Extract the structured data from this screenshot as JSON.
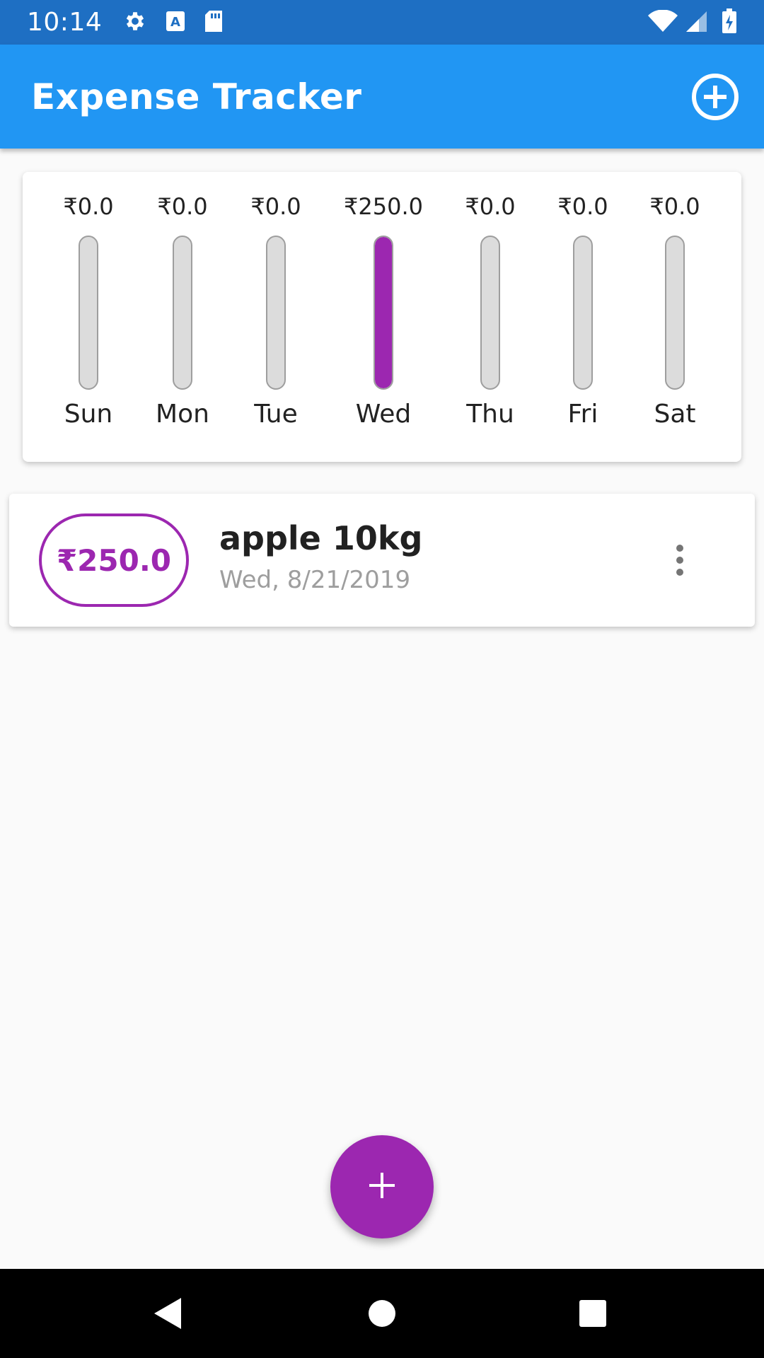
{
  "status_bar": {
    "time": "10:14",
    "left_icons": [
      "settings-icon",
      "a-notification-icon",
      "sd-card-icon"
    ],
    "right_icons": [
      "wifi-icon",
      "cell-signal-icon",
      "battery-charging-icon"
    ]
  },
  "app_bar": {
    "title": "Expense Tracker",
    "action_icon": "add-circle-icon",
    "background": "#2196f3"
  },
  "chart_data": {
    "type": "bar",
    "categories": [
      "Sun",
      "Mon",
      "Tue",
      "Wed",
      "Thu",
      "Fri",
      "Sat"
    ],
    "values": [
      0.0,
      0.0,
      0.0,
      250.0,
      0.0,
      0.0,
      0.0
    ],
    "value_labels": [
      "₹0.0",
      "₹0.0",
      "₹0.0",
      "₹250.0",
      "₹0.0",
      "₹0.0",
      "₹0.0"
    ],
    "fill_fraction": [
      0,
      0,
      0,
      1,
      0,
      0,
      0
    ],
    "bar_color": "#9c27b0",
    "track_color": "#dcdcdc",
    "grid": false
  },
  "transactions": [
    {
      "amount": "₹250.0",
      "title": "apple 10kg",
      "date": "Wed, 8/21/2019",
      "menu_icon": "more-vert-icon"
    }
  ],
  "fab": {
    "icon": "add-icon",
    "color": "#9c27b0"
  },
  "nav_bar": {
    "icons": [
      "back-icon",
      "home-icon",
      "recents-icon"
    ]
  }
}
